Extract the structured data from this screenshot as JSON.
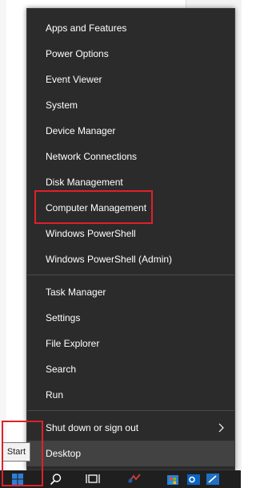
{
  "menu": {
    "items": [
      {
        "label": "Apps and Features"
      },
      {
        "label": "Power Options"
      },
      {
        "label": "Event Viewer"
      },
      {
        "label": "System"
      },
      {
        "label": "Device Manager"
      },
      {
        "label": "Network Connections"
      },
      {
        "label": "Disk Management"
      },
      {
        "label": "Computer Management"
      },
      {
        "label": "Windows PowerShell"
      },
      {
        "label": "Windows PowerShell (Admin)"
      },
      {
        "label": "Task Manager"
      },
      {
        "label": "Settings"
      },
      {
        "label": "File Explorer"
      },
      {
        "label": "Search"
      },
      {
        "label": "Run"
      },
      {
        "label": "Shut down or sign out"
      },
      {
        "label": "Desktop"
      }
    ]
  },
  "tooltip": {
    "label": "Start"
  },
  "taskbar": {
    "icons": [
      "windows-start-icon",
      "search-icon",
      "task-view-icon",
      "app-icon",
      "store-icon",
      "outlook-icon",
      "pen-app-icon"
    ]
  },
  "colors": {
    "menu_bg": "#2b2b2b",
    "hover_bg": "#424242",
    "highlight": "#e0202a",
    "windows_blue": "#2d7fd6"
  }
}
